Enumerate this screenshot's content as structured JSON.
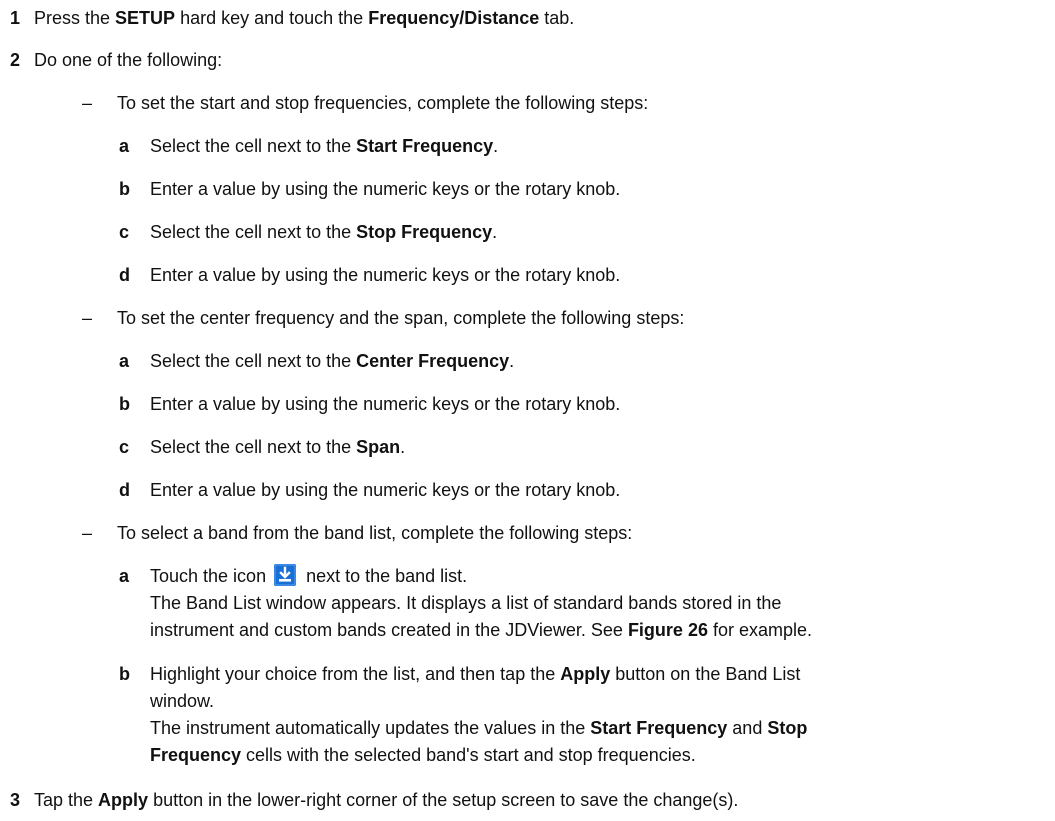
{
  "steps": {
    "s1": {
      "num": "1",
      "pre": "Press the ",
      "b1": "SETUP",
      "mid": " hard key and touch the ",
      "b2": "Frequency/Distance",
      "post": " tab."
    },
    "s2": {
      "num": "2",
      "text": "Do one of the following:"
    },
    "s3": {
      "num": "3",
      "pre": "Tap the ",
      "b1": "Apply",
      "post": " button in the lower-right corner of the setup screen to save the change(s)."
    }
  },
  "options": {
    "dash": "–",
    "o1": {
      "intro": "To set the start and stop frequencies, complete the following steps:",
      "a": {
        "letter": "a",
        "pre": "Select the cell next to the ",
        "bold": "Start Frequency",
        "post": "."
      },
      "b": {
        "letter": "b",
        "text": "Enter a value by using the numeric keys or the rotary knob."
      },
      "c": {
        "letter": "c",
        "pre": "Select the cell next to the ",
        "bold": "Stop Frequency",
        "post": "."
      },
      "d": {
        "letter": "d",
        "text": "Enter a value by using the numeric keys or the rotary knob."
      }
    },
    "o2": {
      "intro": "To set the center frequency and the span, complete the following steps:",
      "a": {
        "letter": "a",
        "pre": "Select the cell next to the ",
        "bold": "Center Frequency",
        "post": "."
      },
      "b": {
        "letter": "b",
        "text": "Enter a value by using the numeric keys or the rotary knob."
      },
      "c": {
        "letter": "c",
        "pre": "Select the cell next to the ",
        "bold": "Span",
        "post": "."
      },
      "d": {
        "letter": "d",
        "text": "Enter a value by using the numeric keys or the rotary knob."
      }
    },
    "o3": {
      "intro": "To select a band from the band list, complete the following steps:",
      "a": {
        "letter": "a",
        "pre": "Touch the icon",
        "post": "next to the band list.",
        "line2": "The Band List window appears. It displays a list of standard bands stored in the",
        "line3pre": "instrument and custom bands created in the JDViewer. See ",
        "line3bold": "Figure 26",
        "line3post": " for example."
      },
      "b": {
        "letter": "b",
        "l1pre": "Highlight your choice from the list, and then tap the ",
        "l1bold": "Apply",
        "l1post": " button on the Band List",
        "l2": "window.",
        "l3pre": "The instrument automatically updates the values in the ",
        "l3bold1": "Start Frequency",
        "l3mid": " and ",
        "l3bold2": "Stop",
        "l4bold": "Frequency",
        "l4post": " cells with the selected band's start and stop frequencies."
      }
    }
  },
  "icon": {
    "name": "download-icon",
    "color": "#1a6fd6"
  }
}
